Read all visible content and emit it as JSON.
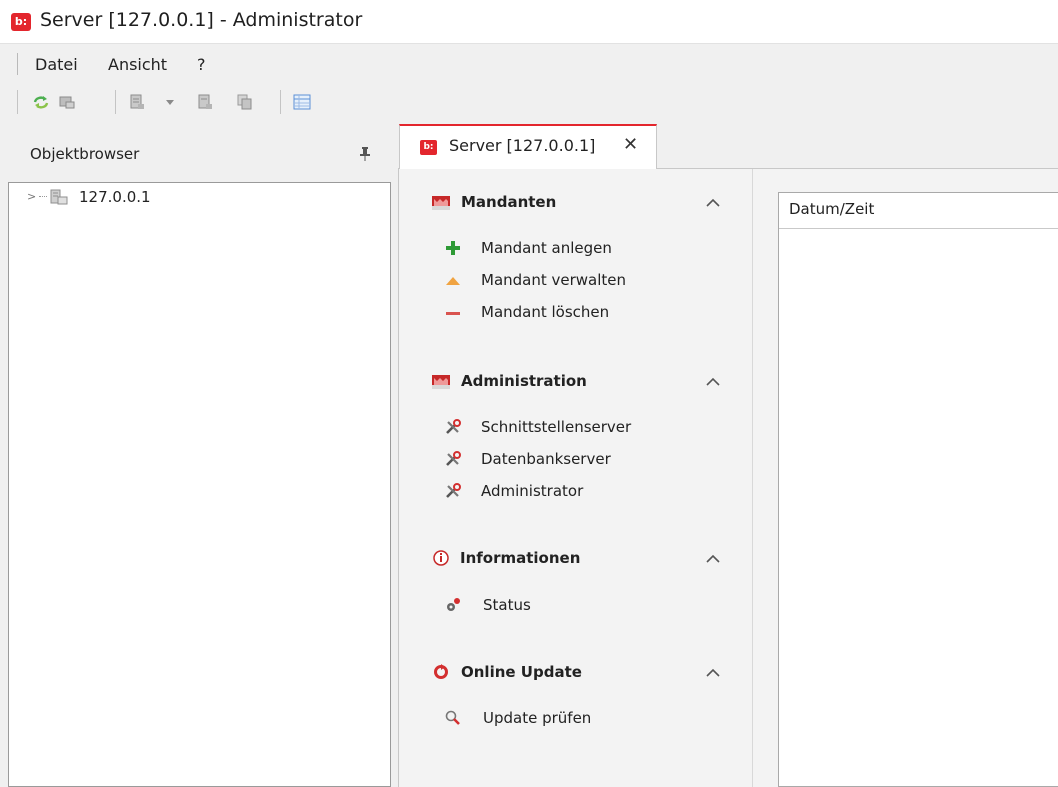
{
  "window": {
    "title": "Server [127.0.0.1] - Administrator",
    "logo": "b:"
  },
  "menu": {
    "items": [
      "Datei",
      "Ansicht",
      "?"
    ]
  },
  "object_browser": {
    "title": "Objektbrowser",
    "tree": [
      {
        "label": "127.0.0.1"
      }
    ]
  },
  "tab": {
    "label": "Server [127.0.0.1]",
    "logo": "b:",
    "close": "✕"
  },
  "sections": [
    {
      "title": "Mandanten",
      "items": [
        "Mandant anlegen",
        "Mandant verwalten",
        "Mandant löschen"
      ]
    },
    {
      "title": "Administration",
      "items": [
        "Schnittstellenserver",
        "Datenbankserver",
        "Administrator"
      ]
    },
    {
      "title": "Informationen",
      "items": [
        "Status"
      ]
    },
    {
      "title": "Online Update",
      "items": [
        "Update prüfen"
      ]
    }
  ],
  "log": {
    "columns": [
      "Datum/Zeit"
    ]
  },
  "colors": {
    "accent": "#e3262d",
    "add": "#2e9a35",
    "manage": "#f0a341",
    "delete": "#d9534f"
  }
}
